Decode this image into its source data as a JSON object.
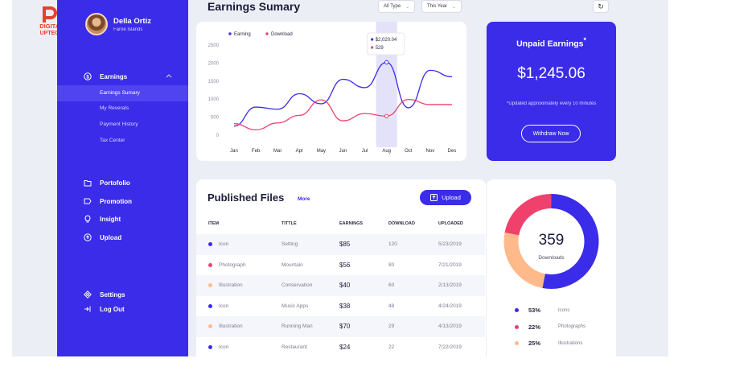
{
  "logo": {
    "line1": "DIGITAL",
    "line2": "UPTECH"
  },
  "profile": {
    "name": "Della Ortiz",
    "location": "Faroe Islands"
  },
  "nav": {
    "earnings": "Earnings",
    "sub": [
      "Earnings Sumary",
      "My Reverals",
      "Payment History",
      "Tax Center"
    ],
    "items": [
      "Portofolio",
      "Promotion",
      "Insight",
      "Upload"
    ],
    "bottom": [
      "Settings",
      "Log Out"
    ]
  },
  "header": {
    "title": "Earnings Sumary",
    "filter_type": "All Type",
    "filter_time": "This Year"
  },
  "chart_data": {
    "type": "line",
    "categories": [
      "Jan",
      "Feb",
      "Mar",
      "Apr",
      "May",
      "Jun",
      "Jul",
      "Aug",
      "Oct",
      "Nov",
      "Des"
    ],
    "ylim": [
      0,
      2500
    ],
    "yticks": [
      0,
      500,
      1000,
      1500,
      2000,
      2500
    ],
    "legend_position": "top-left",
    "highlight_index": 7,
    "tooltip": [
      "$2,020.04",
      "529"
    ],
    "series": [
      {
        "name": "Earning",
        "color": "#3a2ce8",
        "values": [
          250,
          780,
          720,
          1150,
          870,
          1550,
          1320,
          2020,
          760,
          1800,
          1620
        ]
      },
      {
        "name": "Download",
        "color": "#f0416c",
        "values": [
          320,
          150,
          340,
          550,
          980,
          400,
          600,
          529,
          990,
          850,
          850
        ]
      }
    ]
  },
  "unpaid": {
    "title": "Unpaid Earnings",
    "asterisk": "*",
    "amount": "$1,245.06",
    "note": "*Updated approximately every 10 minutes",
    "button": "Withdraw Now"
  },
  "files": {
    "title": "Published Files",
    "more": "More",
    "upload": "Upload",
    "columns": [
      "ITEM",
      "TITTLE",
      "EARNINGS",
      "DOWNLOAD",
      "UPLOADED"
    ],
    "rows": [
      {
        "item": "Icon",
        "title": "Setting",
        "earnings": "$85",
        "download": "120",
        "uploaded": "5/23/2019",
        "color": "#3a2ce8"
      },
      {
        "item": "Photograph",
        "title": "Mountain",
        "earnings": "$56",
        "download": "80",
        "uploaded": "7/21/2019",
        "color": "#f0416c"
      },
      {
        "item": "Illustration",
        "title": "Conservation",
        "earnings": "$40",
        "download": "60",
        "uploaded": "2/13/2019",
        "color": "#ffb98a"
      },
      {
        "item": "Icon",
        "title": "Music Apps",
        "earnings": "$38",
        "download": "48",
        "uploaded": "4/24/2019",
        "color": "#3a2ce8"
      },
      {
        "item": "Illustration",
        "title": "Running Man",
        "earnings": "$70",
        "download": "29",
        "uploaded": "4/13/2019",
        "color": "#ffb98a"
      },
      {
        "item": "Icon",
        "title": "Restaurant",
        "earnings": "$24",
        "download": "22",
        "uploaded": "7/22/2019",
        "color": "#3a2ce8"
      }
    ]
  },
  "downloads": {
    "count": "359",
    "label": "Downloads",
    "segments": [
      {
        "pct": "53%",
        "label": "Icons",
        "value": 53,
        "color": "#3a2ce8"
      },
      {
        "pct": "22%",
        "label": "Photographs",
        "value": 22,
        "color": "#f0416c"
      },
      {
        "pct": "25%",
        "label": "Illustrations",
        "value": 25,
        "color": "#ffb98a"
      }
    ]
  }
}
